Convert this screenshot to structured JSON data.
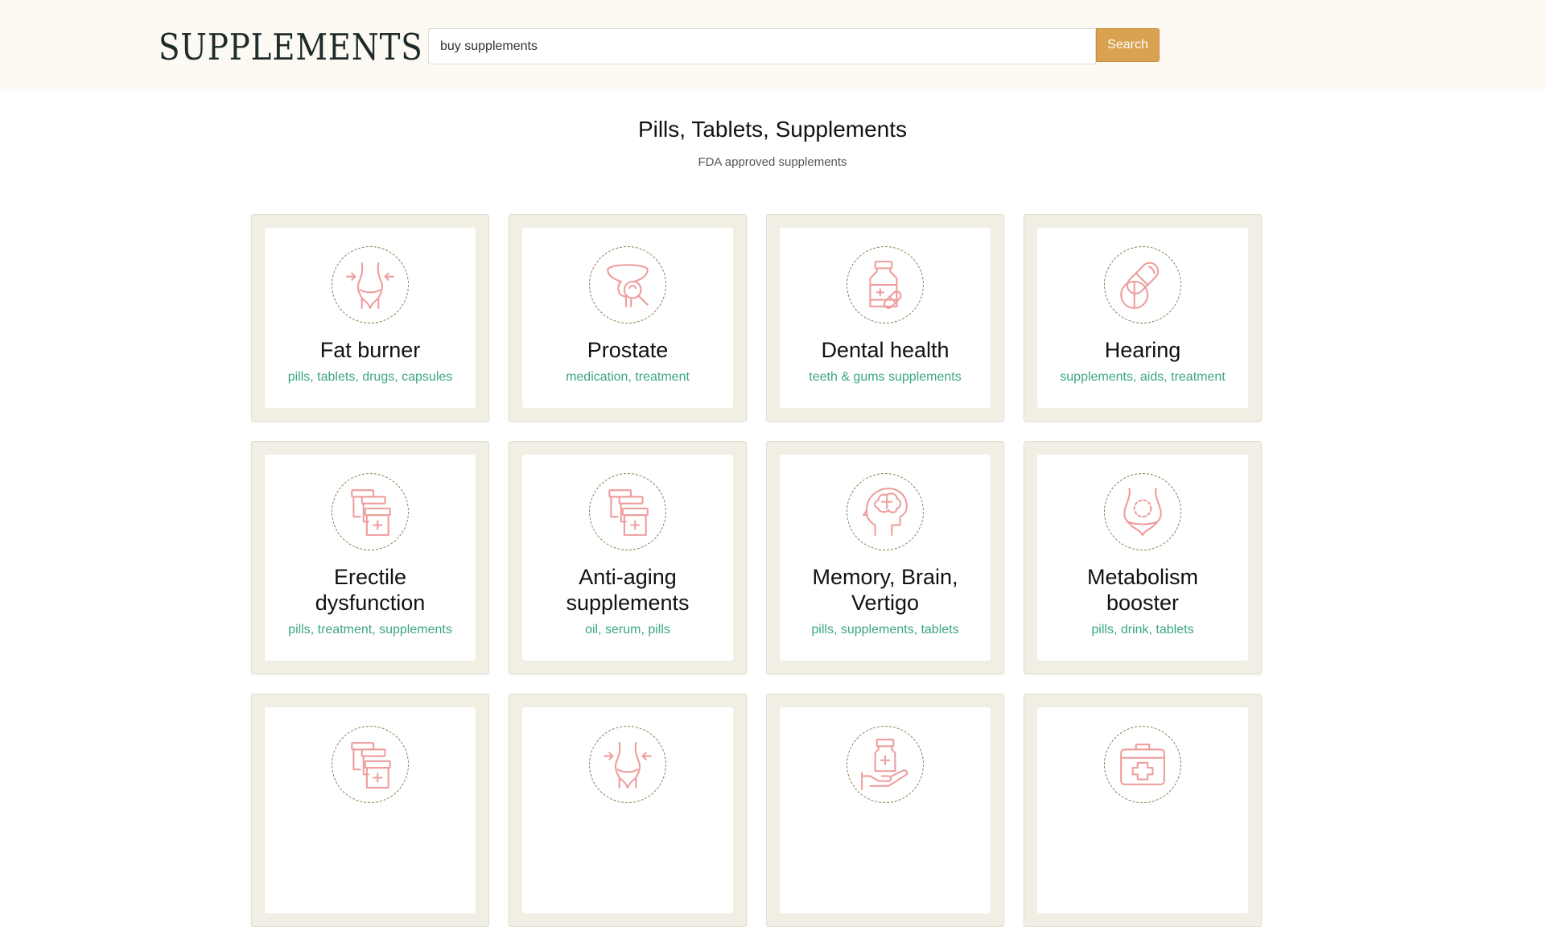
{
  "header": {
    "logo": "SUPPLEMENTS",
    "search_value": "buy supplements",
    "search_button": "Search"
  },
  "hero": {
    "title": "Pills, Tablets, Supplements",
    "subtitle": "FDA approved supplements"
  },
  "colors": {
    "accent": "#d9a251",
    "tag": "#3aa682",
    "icon": "#ee9c9c",
    "card_bg": "#f1eee4"
  },
  "cards": [
    {
      "title": "Fat burner",
      "tags": "pills, tablets, drugs, capsules",
      "icon": "waist-icon"
    },
    {
      "title": "Prostate",
      "tags": "medication, treatment",
      "icon": "prostate-icon"
    },
    {
      "title": "Dental health",
      "tags": "teeth & gums supplements",
      "icon": "medicine-bottle-icon"
    },
    {
      "title": "Hearing",
      "tags": "supplements, aids, treatment",
      "icon": "pills-icon"
    },
    {
      "title": "Erectile dysfunction",
      "tags": "pills, treatment, supplements",
      "icon": "medicine-boxes-icon"
    },
    {
      "title": "Anti-aging supplements",
      "tags": "oil, serum, pills",
      "icon": "medicine-boxes-icon"
    },
    {
      "title": "Memory, Brain, Vertigo",
      "tags": "pills, supplements, tablets",
      "icon": "brain-head-icon"
    },
    {
      "title": "Metabolism booster",
      "tags": "pills, drink, tablets",
      "icon": "belly-icon"
    },
    {
      "title": "",
      "tags": "",
      "icon": "medicine-boxes-icon"
    },
    {
      "title": "",
      "tags": "",
      "icon": "waist-icon"
    },
    {
      "title": "",
      "tags": "",
      "icon": "hand-bottle-icon"
    },
    {
      "title": "",
      "tags": "",
      "icon": "first-aid-kit-icon"
    }
  ]
}
